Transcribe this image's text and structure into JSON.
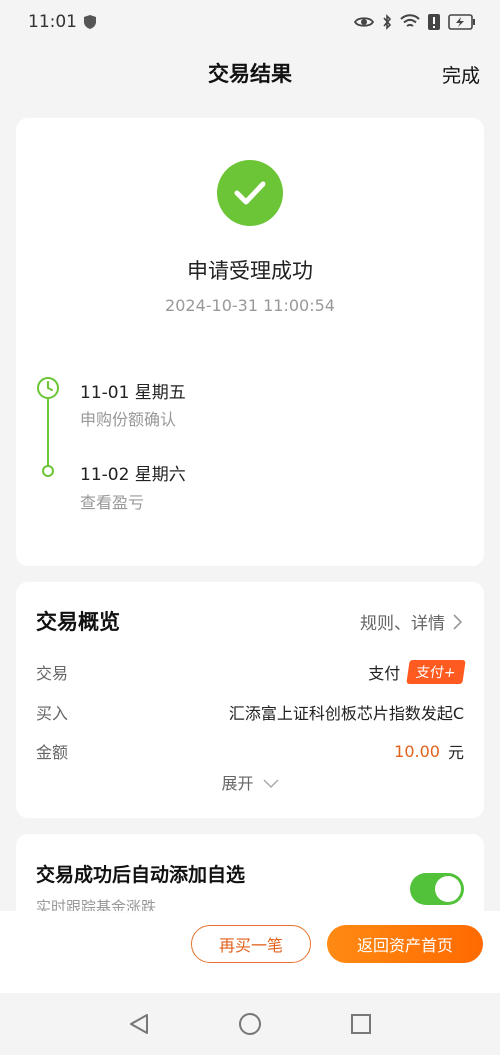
{
  "status_bar": {
    "time": "11:01",
    "icons": [
      "shield-icon",
      "eye-icon",
      "bluetooth-icon",
      "wifi-icon",
      "alert-icon",
      "battery-icon"
    ]
  },
  "header": {
    "title": "交易结果",
    "done_label": "完成"
  },
  "result": {
    "title": "申请受理成功",
    "timestamp": "2024-10-31 11:00:54",
    "timeline": [
      {
        "date": "11-01  星期五",
        "desc": "申购份额确认"
      },
      {
        "date": "11-02  星期六",
        "desc": "查看盈亏"
      }
    ]
  },
  "overview": {
    "title": "交易概览",
    "link_label": "规则、详情",
    "rows": [
      {
        "label": "交易",
        "value": "支付",
        "tag": "支付+"
      },
      {
        "label": "买入",
        "value": "汇添富上证科创板芯片指数发起C"
      },
      {
        "label": "金额",
        "amount": "10.00",
        "unit": "元"
      }
    ],
    "expand_label": "展开"
  },
  "auto_add": {
    "title": "交易成功后自动添加自选",
    "subtitle": "实时跟踪基金涨跌",
    "enabled": true
  },
  "actions": {
    "rebuy_label": "再买一笔",
    "home_label": "返回资产首页"
  },
  "colors": {
    "success_green": "#6cc437",
    "accent_orange": "#ff6a00",
    "amount_orange": "#e2611b",
    "toggle_green": "#52c23a"
  }
}
